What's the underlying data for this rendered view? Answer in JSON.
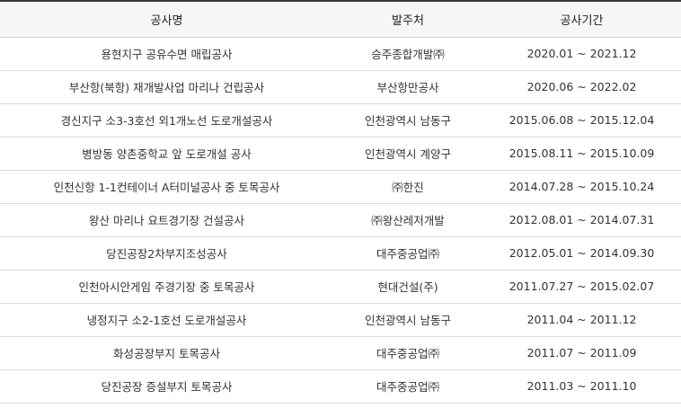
{
  "headers": {
    "name": "공사명",
    "client": "발주처",
    "period": "공사기간"
  },
  "rows": [
    {
      "name": "용현지구 공유수면 매립공사",
      "client": "승주종합개발㈜",
      "period": "2020.01 ~ 2021.12"
    },
    {
      "name": "부산항(북항) 재개발사업 마리나 건립공사",
      "client": "부산항만공사",
      "period": "2020.06 ~ 2022.02"
    },
    {
      "name": "경신지구 소3-3호선 외1개노선 도로개설공사",
      "client": "인천광역시 남동구",
      "period": "2015.06.08 ~ 2015.12.04"
    },
    {
      "name": "병방동 양촌중학교 앞 도로개설 공사",
      "client": "인천광역시 계양구",
      "period": "2015.08.11 ~ 2015.10.09"
    },
    {
      "name": "인천신항 1-1컨테이너 A터미널공사 중 토목공사",
      "client": "㈜한진",
      "period": "2014.07.28 ~ 2015.10.24"
    },
    {
      "name": "왕산 마리나 요트경기장 건설공사",
      "client": "㈜왕산레저개발",
      "period": "2012.08.01 ~ 2014.07.31"
    },
    {
      "name": "당진공장2차부지조성공사",
      "client": "대주중공업㈜",
      "period": "2012.05.01 ~ 2014.09.30"
    },
    {
      "name": "인천아시안게임 주경기장 중 토목공사",
      "client": "현대건설(주)",
      "period": "2011.07.27 ~ 2015.02.07"
    },
    {
      "name": "냉정지구 소2-1호선 도로개설공사",
      "client": "인천광역시 남동구",
      "period": "2011.04 ~ 2011.12"
    },
    {
      "name": "화성공장부지 토목공사",
      "client": "대주중공업㈜",
      "period": "2011.07 ~ 2011.09"
    },
    {
      "name": "당진공장 증설부지 토목공사",
      "client": "대주중공업㈜",
      "period": "2011.03 ~ 2011.10"
    }
  ]
}
